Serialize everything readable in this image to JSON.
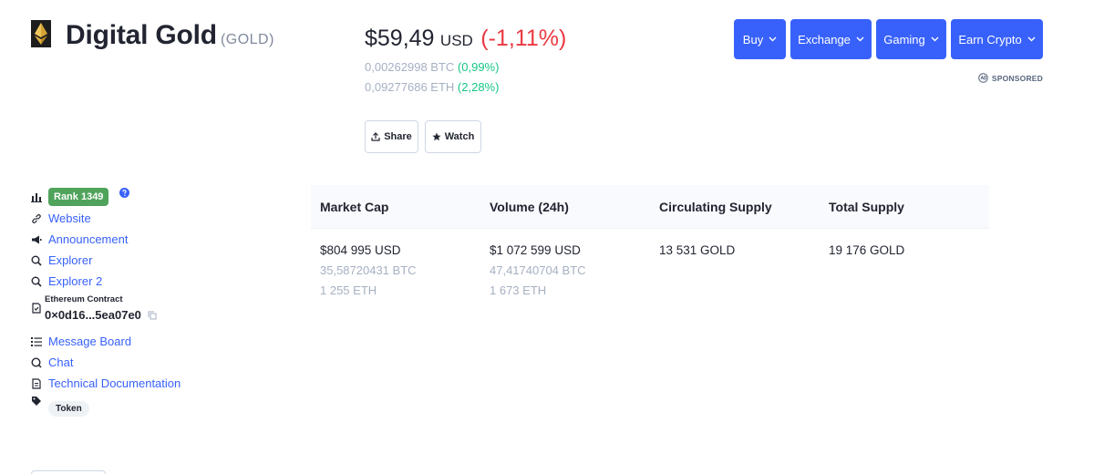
{
  "coin": {
    "name": "Digital Gold",
    "symbol": "(GOLD)",
    "logo_icon": "ethereum-diamond-icon"
  },
  "price": {
    "value": "$59,49",
    "currency": "USD",
    "change": "(-1,11%)",
    "btc_value": "0,00262998 BTC",
    "btc_change": "(0,99%)",
    "eth_value": "0,09277686 ETH",
    "eth_change": "(2,28%)"
  },
  "actions": {
    "share_label": "Share",
    "watch_label": "Watch"
  },
  "menu": {
    "buy": "Buy",
    "exchange": "Exchange",
    "gaming": "Gaming",
    "earn": "Earn Crypto",
    "sponsored": "SPONSORED"
  },
  "sidebar": {
    "rank": "Rank 1349",
    "links": {
      "website": "Website",
      "announcement": "Announcement",
      "explorer": "Explorer",
      "explorer2": "Explorer 2",
      "message_board": "Message Board",
      "chat": "Chat",
      "tech_docs": "Technical Documentation"
    },
    "contract_label": "Ethereum Contract",
    "contract_address": "0×0d16...5ea07e0",
    "tag": "Token"
  },
  "stats": {
    "headers": [
      "Market Cap",
      "Volume (24h)",
      "Circulating Supply",
      "Total Supply"
    ],
    "market_cap": {
      "usd": "$804 995 USD",
      "btc": "35,58720431 BTC",
      "eth": "1 255 ETH"
    },
    "volume": {
      "usd": "$1 072 599 USD",
      "btc": "47,41740704 BTC",
      "eth": "1 673 ETH"
    },
    "circulating_supply": "13 531 GOLD",
    "total_supply": "19 176 GOLD"
  },
  "colors": {
    "accent": "#3861fb",
    "negative": "#ea3943",
    "positive": "#16c784",
    "rank_badge": "#4fa35b"
  }
}
